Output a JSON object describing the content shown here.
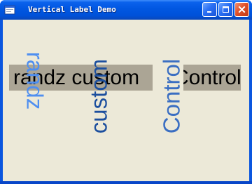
{
  "window": {
    "title": "Vertical Label Demo",
    "controls": {
      "minimize": "minimize",
      "maximize": "maximize",
      "close": "close"
    }
  },
  "labels": {
    "horizontal_left": "randz custom",
    "horizontal_right": "Control",
    "vertical_randz": "randz",
    "vertical_custom": "custom",
    "vertical_control": "Control"
  },
  "colors": {
    "titlebar": "#0055e5",
    "client_background": "#ece9d8",
    "label_background": "#aba595",
    "vertical_randz": "#4f8ff0",
    "vertical_custom": "#1c4f9e",
    "vertical_control": "#3a6ec2"
  }
}
